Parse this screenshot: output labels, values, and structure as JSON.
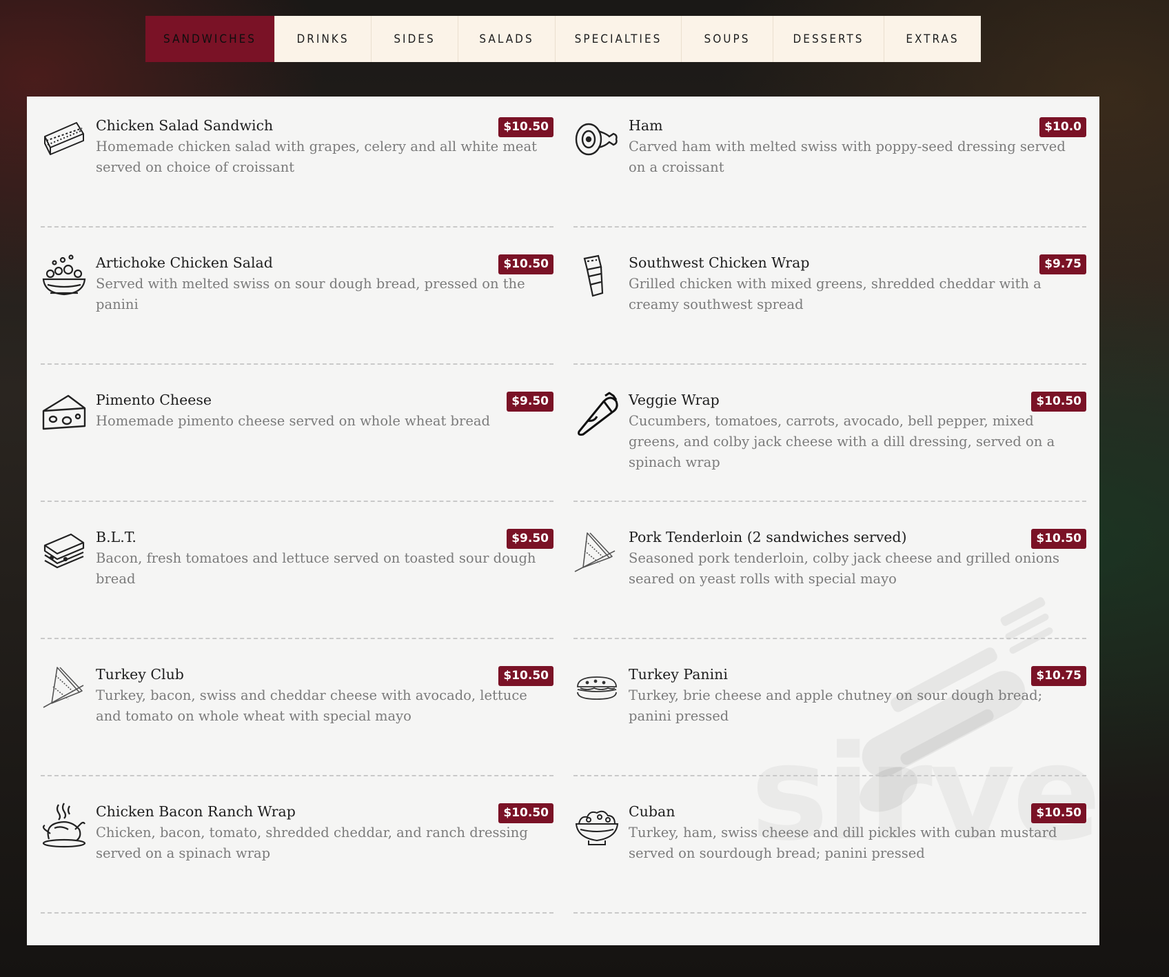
{
  "tabs": [
    {
      "label": "SANDWICHES",
      "active": true
    },
    {
      "label": "DRINKS",
      "active": false
    },
    {
      "label": "SIDES",
      "active": false
    },
    {
      "label": "SALADS",
      "active": false
    },
    {
      "label": "SPECIALTIES",
      "active": false
    },
    {
      "label": "SOUPS",
      "active": false
    },
    {
      "label": "DESSERTS",
      "active": false
    },
    {
      "label": "EXTRAS",
      "active": false
    }
  ],
  "watermark": "sirved",
  "menu": {
    "items": [
      {
        "name": "Chicken Salad Sandwich",
        "price": "$10.50",
        "description": "Homemade chicken salad with grapes, celery and all white meat served on choice of croissant",
        "icon": "club-sandwich-icon"
      },
      {
        "name": "Ham",
        "price": "$10.0",
        "description": "Carved ham with melted swiss with poppy-seed dressing served on a croissant",
        "icon": "ham-leg-icon"
      },
      {
        "name": "Artichoke Chicken Salad",
        "price": "$10.50",
        "description": "Served with melted swiss on sour dough bread, pressed on the panini",
        "icon": "salad-bowl-icon"
      },
      {
        "name": "Southwest Chicken Wrap",
        "price": "$9.75",
        "description": "Grilled chicken with mixed greens, shredded cheddar with a creamy southwest spread",
        "icon": "wrap-icon"
      },
      {
        "name": "Pimento Cheese",
        "price": "$9.50",
        "description": "Homemade pimento cheese served on whole wheat bread",
        "icon": "cheese-icon"
      },
      {
        "name": "Veggie Wrap",
        "price": "$10.50",
        "description": "Cucumbers, tomatoes, carrots, avocado, bell pepper, mixed greens, and colby jack cheese with a dill dressing, served on a spinach wrap",
        "icon": "burrito-icon"
      },
      {
        "name": "B.L.T.",
        "price": "$9.50",
        "description": "Bacon, fresh tomatoes and lettuce served on toasted sour dough bread",
        "icon": "blt-sandwich-icon"
      },
      {
        "name": "Pork Tenderloin (2 sandwiches served)",
        "price": "$10.50",
        "description": "Seasoned pork tenderloin, colby jack cheese and grilled onions seared on yeast rolls with special mayo",
        "icon": "triangle-sandwich-icon"
      },
      {
        "name": "Turkey Club",
        "price": "$10.50",
        "description": "Turkey, bacon, swiss and cheddar cheese with avocado, lettuce and tomato on whole wheat with special mayo",
        "icon": "triangle-sandwich-icon"
      },
      {
        "name": "Turkey Panini",
        "price": "$10.75",
        "description": "Turkey, brie cheese and apple chutney on sour dough bread; panini pressed",
        "icon": "sub-sandwich-icon"
      },
      {
        "name": "Chicken Bacon Ranch Wrap",
        "price": "$10.50",
        "description": "Chicken, bacon, tomato, shredded cheddar, and ranch dressing served on a spinach wrap",
        "icon": "roast-chicken-icon"
      },
      {
        "name": "Cuban",
        "price": "$10.50",
        "description": "Turkey, ham, swiss cheese and dill pickles with cuban mustard served on sourdough bread; panini pressed",
        "icon": "bowl-icon"
      }
    ]
  }
}
